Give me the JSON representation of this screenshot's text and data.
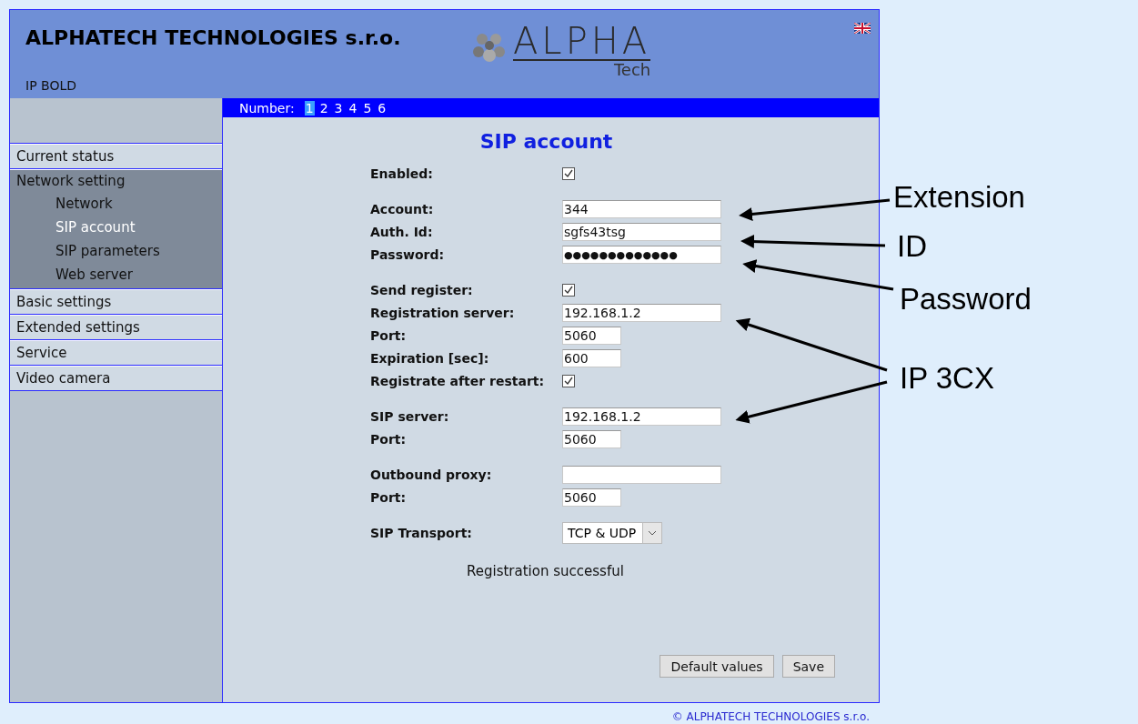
{
  "header": {
    "company": "ALPHATECH TECHNOLOGIES s.r.o.",
    "logo_text": "ALPHA",
    "logo_sub": "Tech",
    "device": "IP BOLD"
  },
  "number_bar": {
    "label": "Number:",
    "numbers": [
      {
        "label": "1",
        "selected": true
      },
      {
        "label": "2",
        "selected": false
      },
      {
        "label": "3",
        "selected": false
      },
      {
        "label": "4",
        "selected": false
      },
      {
        "label": "5",
        "selected": false
      },
      {
        "label": "6",
        "selected": false
      }
    ]
  },
  "sidebar": {
    "items": [
      {
        "label": "Current status",
        "expanded": false
      },
      {
        "label": "Network setting",
        "expanded": true,
        "children": [
          {
            "label": "Network",
            "selected": false
          },
          {
            "label": "SIP account",
            "selected": true
          },
          {
            "label": "SIP parameters",
            "selected": false
          },
          {
            "label": "Web server",
            "selected": false
          }
        ]
      },
      {
        "label": "Basic settings",
        "expanded": false
      },
      {
        "label": "Extended settings",
        "expanded": false
      },
      {
        "label": "Service",
        "expanded": false
      },
      {
        "label": "Video camera",
        "expanded": false
      }
    ]
  },
  "form": {
    "title": "SIP account",
    "groups": [
      [
        {
          "kind": "checkbox",
          "label": "Enabled:",
          "checked": true
        }
      ],
      [
        {
          "kind": "text",
          "label": "Account:",
          "value": "344"
        },
        {
          "kind": "text",
          "label": "Auth. Id:",
          "value": "sgfs43tsg"
        },
        {
          "kind": "password",
          "label": "Password:",
          "value": "●●●●●●●●●●●●●"
        }
      ],
      [
        {
          "kind": "checkbox",
          "label": "Send register:",
          "checked": true
        },
        {
          "kind": "text",
          "label": "Registration server:",
          "value": "192.168.1.2"
        },
        {
          "kind": "short",
          "label": "Port:",
          "value": "5060"
        },
        {
          "kind": "short",
          "label": "Expiration [sec]:",
          "value": "600"
        },
        {
          "kind": "checkbox",
          "label": "Registrate after restart:",
          "checked": true
        }
      ],
      [
        {
          "kind": "text",
          "label": "SIP server:",
          "value": "192.168.1.2"
        },
        {
          "kind": "short",
          "label": "Port:",
          "value": "5060"
        }
      ],
      [
        {
          "kind": "text",
          "label": "Outbound proxy:"
        },
        {
          "kind": "short",
          "label": "Port:",
          "value": "5060"
        }
      ],
      [
        {
          "kind": "select",
          "label": "SIP Transport:",
          "value": "TCP & UDP"
        }
      ]
    ],
    "status": "Registration successful",
    "buttons": [
      "Default values",
      "Save"
    ]
  },
  "footer": "© ALPHATECH TECHNOLOGIES s.r.o.",
  "annotations": [
    {
      "label": "Extension"
    },
    {
      "label": "ID"
    },
    {
      "label": "Password"
    },
    {
      "label": "IP 3CX"
    }
  ]
}
